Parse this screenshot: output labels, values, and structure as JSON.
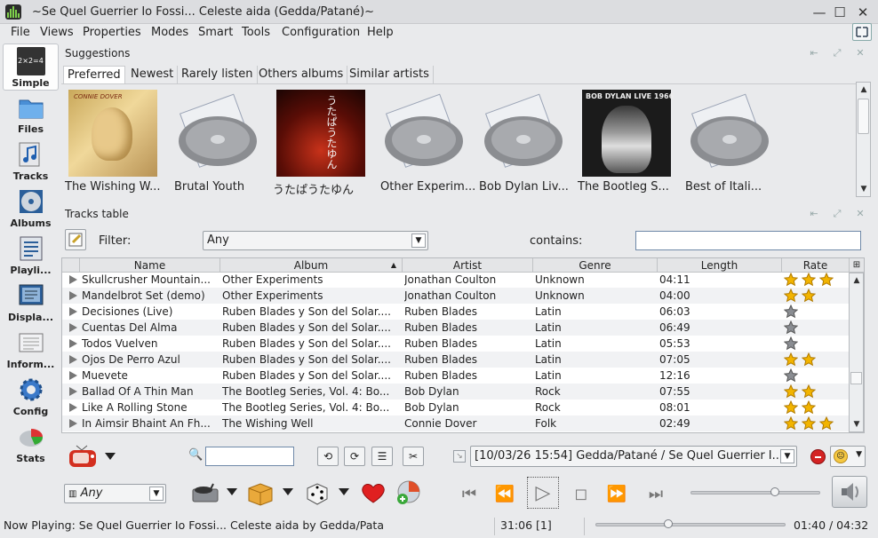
{
  "window": {
    "title": "~Se Quel Guerrier Io Fossi... Celeste aida (Gedda/Patané)~",
    "minimize": "—",
    "maximize": "☐",
    "close": "✕"
  },
  "menu": [
    "File",
    "Views",
    "Properties",
    "Modes",
    "Smart",
    "Tools",
    "Configuration",
    "Help"
  ],
  "sidebar": {
    "items": [
      {
        "label": "Simple",
        "icon": "simple-icon",
        "icon_text": "2×2=4"
      },
      {
        "label": "Files",
        "icon": "folder-icon"
      },
      {
        "label": "Tracks",
        "icon": "music-note-icon"
      },
      {
        "label": "Albums",
        "icon": "cd-icon"
      },
      {
        "label": "Playli...",
        "icon": "playlist-icon"
      },
      {
        "label": "Displa...",
        "icon": "display-icon"
      },
      {
        "label": "Inform...",
        "icon": "information-icon"
      },
      {
        "label": "Config",
        "icon": "gear-icon"
      },
      {
        "label": "Stats",
        "icon": "pie-chart-icon"
      }
    ]
  },
  "suggestions": {
    "title": "Suggestions",
    "tabs": [
      "Preferred",
      "Newest",
      "Rarely listen",
      "Others albums",
      "Similar artists"
    ],
    "albums": [
      {
        "title": "The Wishing W...",
        "cover": "connie-dover-cover",
        "cover_text": "CONNIE DOVER"
      },
      {
        "title": "Brutal Youth",
        "cover": "empty-cd-case"
      },
      {
        "title": "うたぱうたゆん",
        "cover": "red-japanese-cover",
        "cover_text": "うたぱうたゆん"
      },
      {
        "title": "Other Experim...",
        "cover": "empty-cd-case"
      },
      {
        "title": "Bob Dylan Liv...",
        "cover": "empty-cd-case"
      },
      {
        "title": "The Bootleg S...",
        "cover": "bob-dylan-live-cover",
        "cover_text": "BOB DYLAN LIVE 1966"
      },
      {
        "title": "Best of Itali...",
        "cover": "empty-cd-case"
      }
    ]
  },
  "tracks": {
    "title": "Tracks table",
    "filter_label": "Filter:",
    "filter_value": "Any",
    "contains_label": "contains:",
    "contains_value": "",
    "columns": [
      "Name",
      "Album",
      "Artist",
      "Genre",
      "Length",
      "Rate"
    ],
    "rows": [
      {
        "name": "Skullcrusher Mountain...",
        "album": "Other Experiments",
        "artist": "Jonathan Coulton",
        "genre": "Unknown",
        "length": "04:11",
        "rate": 3
      },
      {
        "name": "Mandelbrot Set (demo)",
        "album": "Other Experiments",
        "artist": "Jonathan Coulton",
        "genre": "Unknown",
        "length": "04:00",
        "rate": 2
      },
      {
        "name": "Decisiones (Live)",
        "album": "Ruben Blades y Son del Solar....",
        "artist": "Ruben Blades",
        "genre": "Latin",
        "length": "06:03",
        "rate": 0
      },
      {
        "name": "Cuentas Del Alma",
        "album": "Ruben Blades y Son del Solar....",
        "artist": "Ruben Blades",
        "genre": "Latin",
        "length": "06:49",
        "rate": 0
      },
      {
        "name": "Todos Vuelven",
        "album": "Ruben Blades y Son del Solar....",
        "artist": "Ruben Blades",
        "genre": "Latin",
        "length": "05:53",
        "rate": 0
      },
      {
        "name": "Ojos De Perro Azul",
        "album": "Ruben Blades y Son del Solar....",
        "artist": "Ruben Blades",
        "genre": "Latin",
        "length": "07:05",
        "rate": 2
      },
      {
        "name": "Muevete",
        "album": "Ruben Blades y Son del Solar....",
        "artist": "Ruben Blades",
        "genre": "Latin",
        "length": "12:16",
        "rate": 0
      },
      {
        "name": "Ballad Of A Thin Man",
        "album": "The Bootleg Series, Vol. 4: Bo...",
        "artist": "Bob Dylan",
        "genre": "Rock",
        "length": "07:55",
        "rate": 2
      },
      {
        "name": "Like A Rolling Stone",
        "album": "The Bootleg Series, Vol. 4: Bo...",
        "artist": "Bob Dylan",
        "genre": "Rock",
        "length": "08:01",
        "rate": 2
      },
      {
        "name": "In Aimsir Bhaint An Fh...",
        "album": "The Wishing Well",
        "artist": "Connie Dover",
        "genre": "Folk",
        "length": "02:49",
        "rate": 3
      }
    ]
  },
  "controls": {
    "history_entry": "[10/03/26 15:54] Gedda/Patané / Se Quel Guerrier I...",
    "search_value": "",
    "ambience_value": "Any"
  },
  "status": {
    "now_playing": "Now Playing:  Se Quel Guerrier Io Fossi... Celeste aida by Gedda/Pata",
    "total": "31:06 [1]",
    "time": "01:40 / 04:32",
    "position_fraction": 0.385,
    "volume_fraction": 0.65
  },
  "colors": {
    "accent": "#6f89a8",
    "star": "#f2b400",
    "selected_tab": "#ffffff"
  }
}
